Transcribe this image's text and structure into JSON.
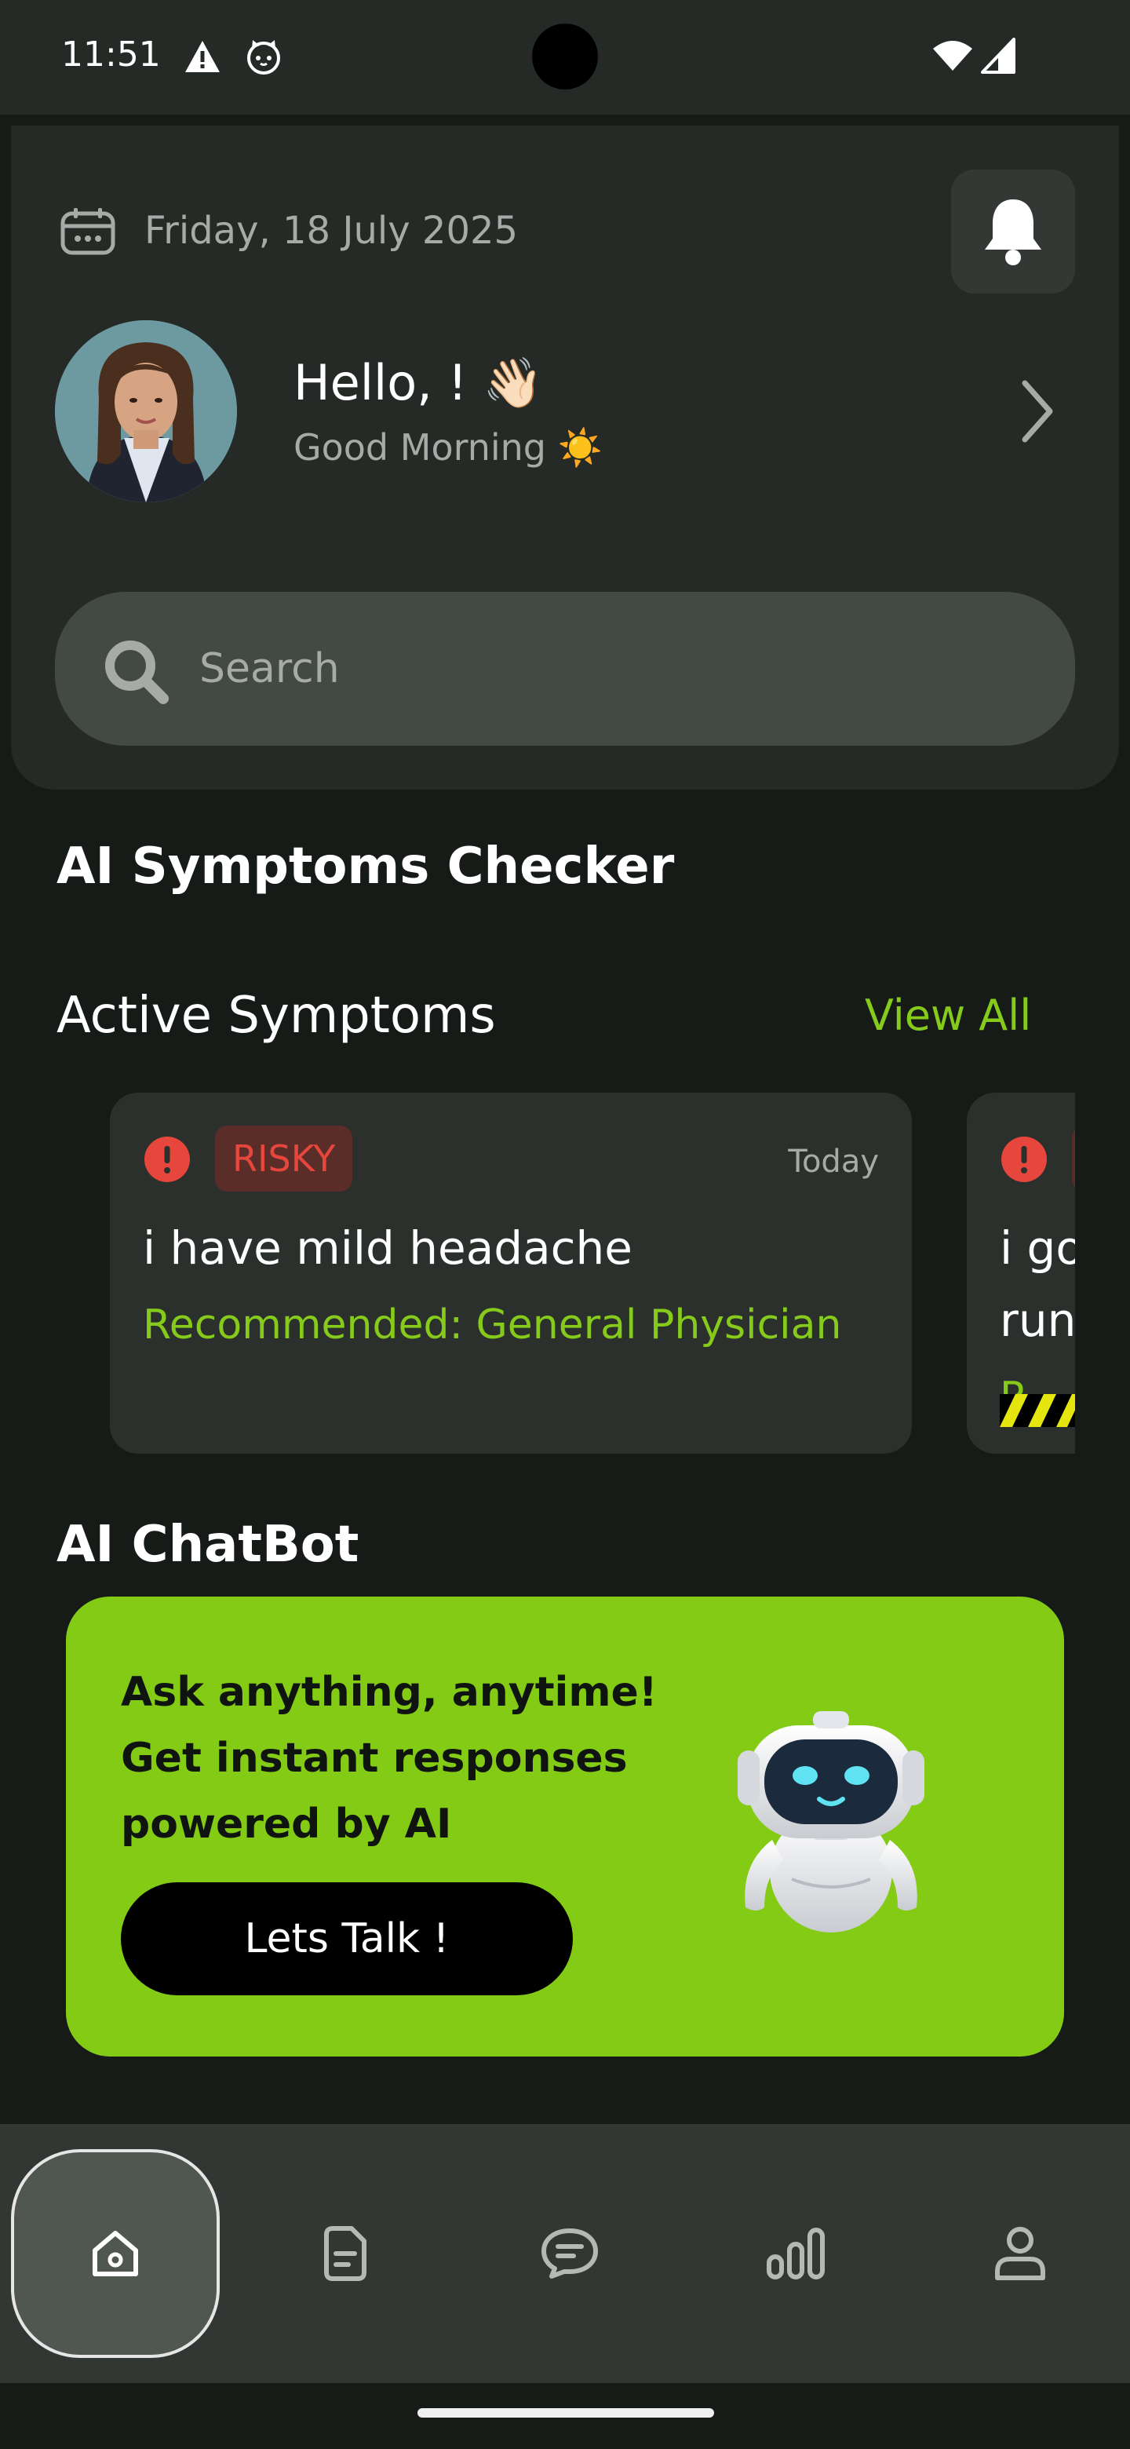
{
  "status_bar": {
    "time": "11:51",
    "icons": [
      "warning-icon",
      "cat-icon",
      "wifi-icon",
      "signal-icon"
    ]
  },
  "header": {
    "date": "Friday, 18 July 2025",
    "greeting": "Hello,  ! ",
    "greeting_emoji": "👋🏻",
    "subgreeting": "Good Morning ☀️",
    "search_placeholder": "Search"
  },
  "sections": {
    "symptoms_checker_title": "AI Symptoms Checker",
    "active_symptoms_title": "Active Symptoms",
    "view_all_label": "View All",
    "chatbot_title": "AI ChatBot"
  },
  "symptoms": [
    {
      "badge": "RISKY",
      "date": "Today",
      "text": "i have mild headache",
      "recommendation": "Recommended: General Physician"
    },
    {
      "badge": "R",
      "text_line1": "i go",
      "text_line2": "run",
      "recommendation": "R"
    }
  ],
  "chatbot": {
    "text_line1": "Ask anything, anytime!",
    "text_line2": "Get instant responses",
    "text_line3": "powered by AI",
    "button_label": "Lets Talk !"
  },
  "bottom_nav": {
    "items": [
      "home-icon",
      "document-icon",
      "chat-icon",
      "chart-icon",
      "profile-icon"
    ],
    "active_index": 0
  },
  "colors": {
    "accent": "#84cb15",
    "background": "#161b18",
    "card": "#252a27",
    "risk": "#e6463c"
  }
}
